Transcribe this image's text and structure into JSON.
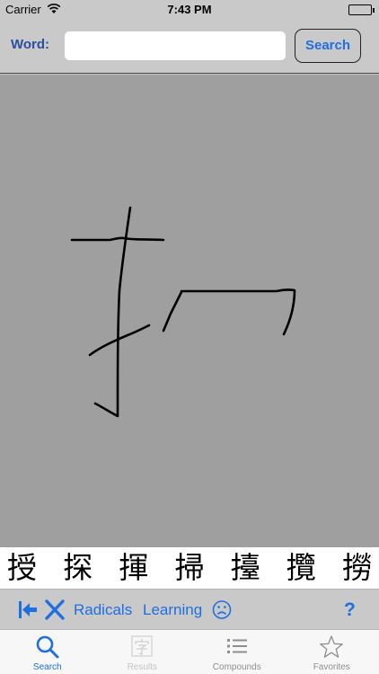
{
  "status_bar": {
    "carrier": "Carrier",
    "time": "7:43 PM"
  },
  "search_header": {
    "word_label": "Word:",
    "word_value": "",
    "search_label": "Search"
  },
  "candidates": [
    "授",
    "探",
    "揮",
    "掃",
    "擡",
    "攬",
    "撈"
  ],
  "toolbar": {
    "radicals_label": "Radicals",
    "learning_label": "Learning",
    "help_label": "?"
  },
  "tab_bar": {
    "tabs": [
      {
        "label": "Search",
        "icon": "magnifier-icon",
        "state": "active"
      },
      {
        "label": "Results",
        "icon": "character-card-icon",
        "state": "disabled"
      },
      {
        "label": "Compounds",
        "icon": "list-icon",
        "state": "normal"
      },
      {
        "label": "Favorites",
        "icon": "star-icon",
        "state": "normal"
      }
    ]
  },
  "colors": {
    "accent": "#1f6fe0",
    "label_blue": "#2a4f9e",
    "canvas": "#9f9f9f",
    "bars": "#c9c9c9"
  }
}
